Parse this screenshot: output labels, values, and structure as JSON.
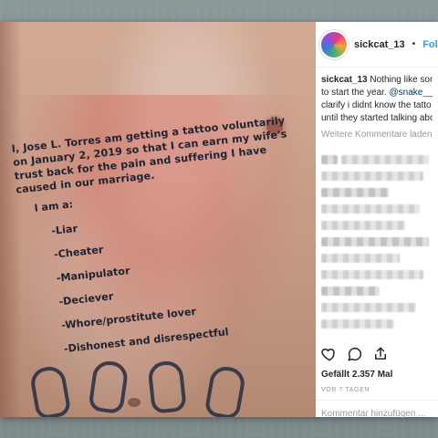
{
  "post": {
    "username": "sickcat_13",
    "follow_separator": "•",
    "follow_label": "Folgen",
    "caption_lines": [
      {
        "user": "sickcat_13",
        "text": " Nothing like som"
      },
      {
        "text": "to start the year. ",
        "mention": "@snake__p"
      },
      {
        "text": "clarify i didnt know the tatto"
      },
      {
        "text": "until they started talking abo"
      }
    ],
    "more_comments_label": "Weitere Kommentare laden",
    "likes_label": "Gefällt 2.357 Mal",
    "time_label": "VOR 7 TAGEN",
    "add_comment_placeholder": "Kommentar hinzufügen ...",
    "actions": [
      {
        "name": "like",
        "icon": "heart-icon"
      },
      {
        "name": "comment",
        "icon": "comment-icon"
      },
      {
        "name": "share",
        "icon": "share-icon"
      }
    ]
  },
  "tattoo": {
    "main_lines": [
      "I, Jose L. Torres am getting a tattoo voluntarily",
      "on January 2, 2019 so that I can earn my wife's",
      "trust back for the pain and suffering I have",
      "caused in our marriage."
    ],
    "iam_label": "I am a:",
    "list": [
      "-Liar",
      "-Cheater",
      "-Manipulator",
      "-Deciever",
      "-Whore/prostitute lover",
      "-Dishonest and disrespectful"
    ]
  },
  "colors": {
    "follow_blue": "#3897f0",
    "mention_blue": "#003569",
    "muted_gray": "#999999",
    "text_dark": "#262626"
  }
}
